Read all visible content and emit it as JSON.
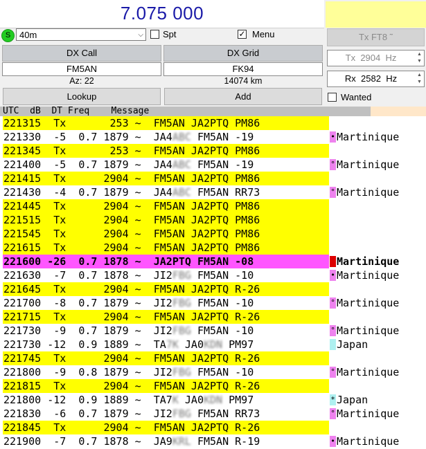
{
  "header": {
    "frequency": "7.075 000"
  },
  "band": {
    "s_led": "S",
    "selected": "40m"
  },
  "options": {
    "spt_label": "Spt",
    "spt_checked": false,
    "menu_label": "Menu",
    "menu_checked": true
  },
  "mode_button": "Tx FT8 ˜",
  "dx": {
    "call_label": "DX Call",
    "grid_label": "DX Grid",
    "call_value": "FM5AN",
    "grid_value": "FK94",
    "azimuth": "Az: 22",
    "distance": "14074 km",
    "lookup_label": "Lookup",
    "add_label": "Add"
  },
  "tx_freq": {
    "label": "Tx",
    "value": "2904",
    "unit": "Hz"
  },
  "rx_freq": {
    "label": "Rx",
    "value": "2582",
    "unit": "Hz"
  },
  "wanted": {
    "label": "Wanted",
    "checked": false
  },
  "columns_header": "UTC  dB  DT Freq    Message",
  "colors": {
    "tx_row": "#ffff00",
    "highlight_row": "#ff55ff",
    "dx_flag": "#ee82ee",
    "japan_flag": "#aef0f0"
  },
  "messages": [
    {
      "utc": "221315",
      "db": "Tx",
      "dt": "",
      "freq": "253",
      "msg_a": "FM5AN JA2PTQ PM86",
      "hidden": "",
      "msg_b": "",
      "type": "tx",
      "flag": "",
      "country": ""
    },
    {
      "utc": "221330",
      "db": "-5",
      "dt": "0.7",
      "freq": "1879",
      "msg_a": "JA4",
      "hidden": "ABC",
      "msg_b": " FM5AN -19",
      "type": "rx",
      "flag": "•",
      "flag_color": "#ee82ee",
      "country": "Martinique"
    },
    {
      "utc": "221345",
      "db": "Tx",
      "dt": "",
      "freq": "253",
      "msg_a": "FM5AN JA2PTQ PM86",
      "hidden": "",
      "msg_b": "",
      "type": "tx",
      "flag": "",
      "country": ""
    },
    {
      "utc": "221400",
      "db": "-5",
      "dt": "0.7",
      "freq": "1879",
      "msg_a": "JA4",
      "hidden": "ABC",
      "msg_b": " FM5AN -19",
      "type": "rx",
      "flag": "°",
      "flag_color": "#ee82ee",
      "country": "Martinique"
    },
    {
      "utc": "221415",
      "db": "Tx",
      "dt": "",
      "freq": "2904",
      "msg_a": "FM5AN JA2PTQ PM86",
      "hidden": "",
      "msg_b": "",
      "type": "tx",
      "flag": "",
      "country": ""
    },
    {
      "utc": "221430",
      "db": "-4",
      "dt": "0.7",
      "freq": "1879",
      "msg_a": "JA4",
      "hidden": "ABC",
      "msg_b": " FM5AN RR73",
      "type": "rx",
      "flag": "°",
      "flag_color": "#ee82ee",
      "country": "Martinique"
    },
    {
      "utc": "221445",
      "db": "Tx",
      "dt": "",
      "freq": "2904",
      "msg_a": "FM5AN JA2PTQ PM86",
      "hidden": "",
      "msg_b": "",
      "type": "tx",
      "flag": "",
      "country": ""
    },
    {
      "utc": "221515",
      "db": "Tx",
      "dt": "",
      "freq": "2904",
      "msg_a": "FM5AN JA2PTQ PM86",
      "hidden": "",
      "msg_b": "",
      "type": "tx",
      "flag": "",
      "country": ""
    },
    {
      "utc": "221545",
      "db": "Tx",
      "dt": "",
      "freq": "2904",
      "msg_a": "FM5AN JA2PTQ PM86",
      "hidden": "",
      "msg_b": "",
      "type": "tx",
      "flag": "",
      "country": ""
    },
    {
      "utc": "221615",
      "db": "Tx",
      "dt": "",
      "freq": "2904",
      "msg_a": "FM5AN JA2PTQ PM86",
      "hidden": "",
      "msg_b": "",
      "type": "tx",
      "flag": "",
      "country": ""
    },
    {
      "utc": "221600",
      "db": "-26",
      "dt": "0.7",
      "freq": "1878",
      "msg_a": "JA2PTQ FM5AN -08",
      "hidden": "",
      "msg_b": "",
      "type": "highlight",
      "flag": "",
      "flag_color": "#dd0000",
      "country": "Martinique"
    },
    {
      "utc": "221630",
      "db": "-7",
      "dt": "0.7",
      "freq": "1878",
      "msg_a": "JI2",
      "hidden": "FBG",
      "msg_b": " FM5AN -10",
      "type": "rx",
      "flag": "•",
      "flag_color": "#ee82ee",
      "country": "Martinique"
    },
    {
      "utc": "221645",
      "db": "Tx",
      "dt": "",
      "freq": "2904",
      "msg_a": "FM5AN JA2PTQ R-26",
      "hidden": "",
      "msg_b": "",
      "type": "tx",
      "flag": "",
      "country": ""
    },
    {
      "utc": "221700",
      "db": "-8",
      "dt": "0.7",
      "freq": "1879",
      "msg_a": "JI2",
      "hidden": "FBG",
      "msg_b": " FM5AN -10",
      "type": "rx",
      "flag": "°",
      "flag_color": "#ee82ee",
      "country": "Martinique"
    },
    {
      "utc": "221715",
      "db": "Tx",
      "dt": "",
      "freq": "2904",
      "msg_a": "FM5AN JA2PTQ R-26",
      "hidden": "",
      "msg_b": "",
      "type": "tx",
      "flag": "",
      "country": ""
    },
    {
      "utc": "221730",
      "db": "-9",
      "dt": "0.7",
      "freq": "1879",
      "msg_a": "JI2",
      "hidden": "FBG",
      "msg_b": " FM5AN -10",
      "type": "rx",
      "flag": "°",
      "flag_color": "#ee82ee",
      "country": "Martinique"
    },
    {
      "utc": "221730",
      "db": "-12",
      "dt": "0.9",
      "freq": "1889",
      "msg_a": "TA",
      "hidden": "7K",
      "msg_b": " JA0",
      "hidden2": "KDN",
      "msg_c": " PM97",
      "type": "rx",
      "flag": "",
      "flag_color": "#aef0f0",
      "country": "Japan"
    },
    {
      "utc": "221745",
      "db": "Tx",
      "dt": "",
      "freq": "2904",
      "msg_a": "FM5AN JA2PTQ R-26",
      "hidden": "",
      "msg_b": "",
      "type": "tx",
      "flag": "",
      "country": ""
    },
    {
      "utc": "221800",
      "db": "-9",
      "dt": "0.8",
      "freq": "1879",
      "msg_a": "JI2",
      "hidden": "FBG",
      "msg_b": " FM5AN -10",
      "type": "rx",
      "flag": "°",
      "flag_color": "#ee82ee",
      "country": "Martinique"
    },
    {
      "utc": "221815",
      "db": "Tx",
      "dt": "",
      "freq": "2904",
      "msg_a": "FM5AN JA2PTQ R-26",
      "hidden": "",
      "msg_b": "",
      "type": "tx",
      "flag": "",
      "country": ""
    },
    {
      "utc": "221800",
      "db": "-12",
      "dt": "0.9",
      "freq": "1889",
      "msg_a": "TA7",
      "hidden": "K",
      "msg_b": " JA0",
      "hidden2": "KDN",
      "msg_c": " PM97",
      "type": "rx",
      "flag": "*",
      "flag_color": "#aef0f0",
      "country": "Japan"
    },
    {
      "utc": "221830",
      "db": "-6",
      "dt": "0.7",
      "freq": "1879",
      "msg_a": "JI2",
      "hidden": "FBG",
      "msg_b": " FM5AN RR73",
      "type": "rx",
      "flag": "°",
      "flag_color": "#ee82ee",
      "country": "Martinique"
    },
    {
      "utc": "221845",
      "db": "Tx",
      "dt": "",
      "freq": "2904",
      "msg_a": "FM5AN JA2PTQ R-26",
      "hidden": "",
      "msg_b": "",
      "type": "tx",
      "flag": "",
      "country": ""
    },
    {
      "utc": "221900",
      "db": "-7",
      "dt": "0.7",
      "freq": "1878",
      "msg_a": "JA9",
      "hidden": "KRL",
      "msg_b": " FM5AN R-19",
      "type": "rx",
      "flag": "•",
      "flag_color": "#ee82ee",
      "country": "Martinique"
    }
  ]
}
